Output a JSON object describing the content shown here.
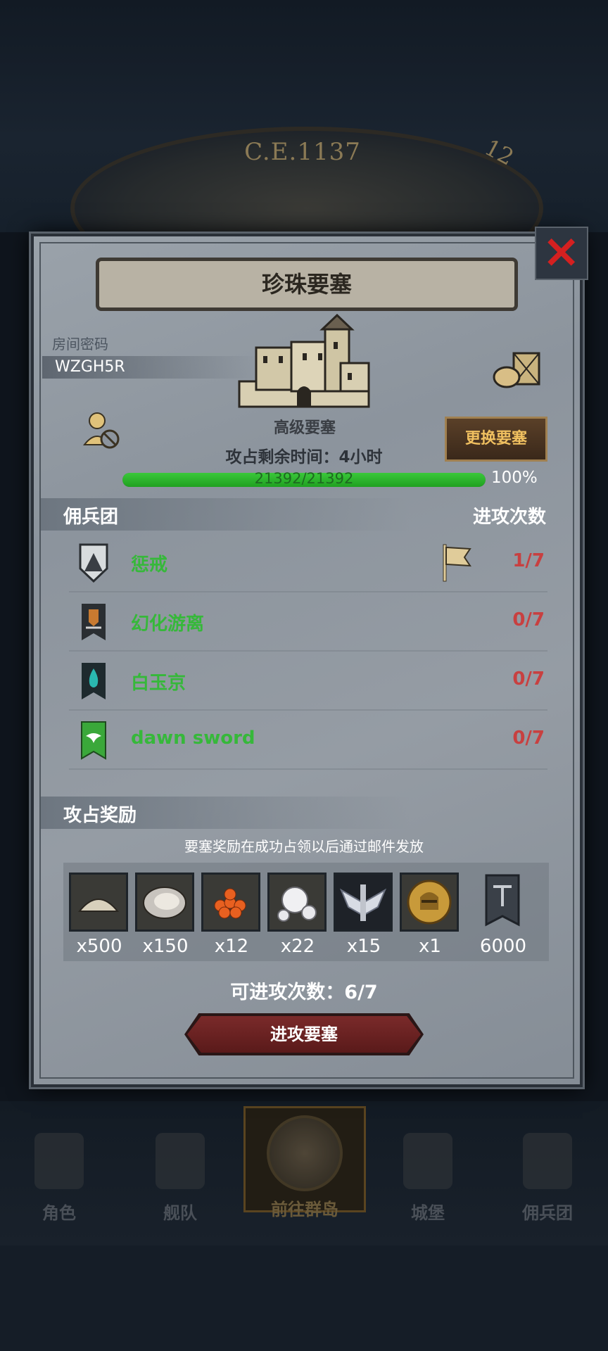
{
  "era": {
    "year": "C.E.1137",
    "count": "12"
  },
  "dialog": {
    "title": "珍珠要塞",
    "close": "×",
    "room": {
      "label": "房间密码",
      "code": "WZGH5R"
    },
    "fortress": {
      "type": "高级要塞",
      "change_label": "更换要塞",
      "occupy_time": "攻占剩余时间：4小时",
      "hp_text": "21392/21392",
      "hp_fraction": 1.0,
      "hp_pct": "100%"
    },
    "mercs": {
      "header_left": "佣兵团",
      "header_right": "进攻次数",
      "rows": [
        {
          "name": "惩戒",
          "count": "1/7",
          "emblem": "shield-mountain-icon",
          "color": "#e8e8e8"
        },
        {
          "name": "幻化游离",
          "count": "0/7",
          "emblem": "banner-crest-icon",
          "color": "#d0d0d0"
        },
        {
          "name": "白玉京",
          "count": "0/7",
          "emblem": "banner-flame-icon",
          "color": "#2aa8a0"
        },
        {
          "name": "dawn sword",
          "count": "0/7",
          "emblem": "banner-dove-icon",
          "color": "#3aa83a"
        }
      ]
    },
    "rewards": {
      "header": "攻占奖励",
      "note": "要塞奖励在成功占领以后通过邮件发放",
      "items": [
        {
          "icon": "flour-icon",
          "qty": "x500"
        },
        {
          "icon": "oyster-icon",
          "qty": "x150"
        },
        {
          "icon": "fish-roe-icon",
          "qty": "x12"
        },
        {
          "icon": "pearl-icon",
          "qty": "x22"
        },
        {
          "icon": "winged-emblem-icon",
          "qty": "x15"
        },
        {
          "icon": "knight-helmet-coin-icon",
          "qty": "x1"
        },
        {
          "icon": "banner-icon",
          "qty": "6000"
        }
      ]
    },
    "attacks_left": "可进攻次数：6/7",
    "attack_button": "进攻要塞"
  },
  "nav": [
    {
      "label": "角色",
      "icon": "knight-icon"
    },
    {
      "label": "舰队",
      "icon": "ship-icon"
    },
    {
      "label": "前往群岛",
      "icon": "compass-icon"
    },
    {
      "label": "城堡",
      "icon": "castle-icon"
    },
    {
      "label": "佣兵团",
      "icon": "mercenary-icon"
    }
  ]
}
